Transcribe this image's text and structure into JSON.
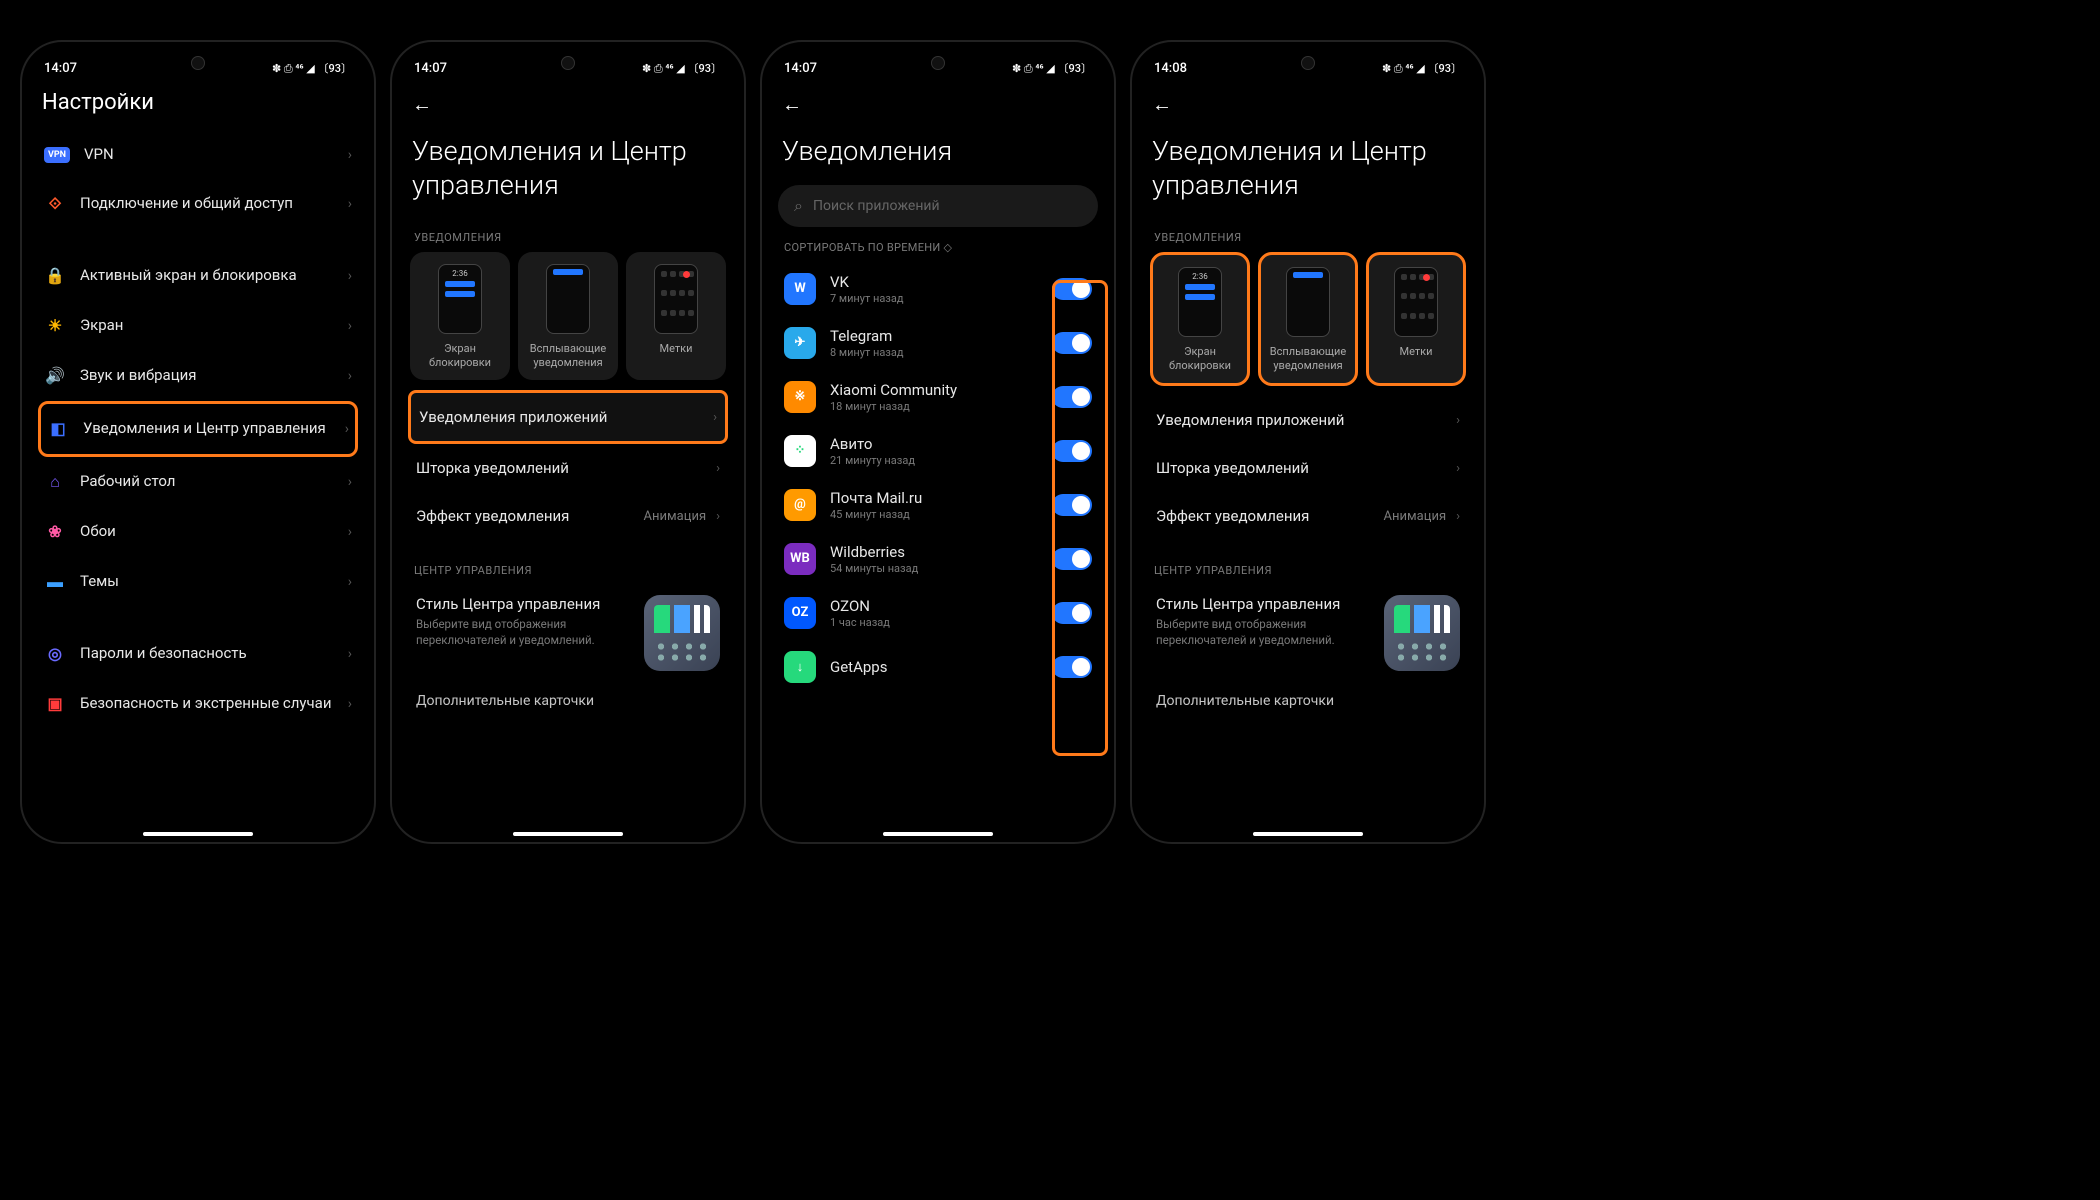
{
  "status": {
    "time1": "14:07",
    "time4": "14:08",
    "icons": "✽ ⎙ ⁴⁶ ◢ 〔93〕"
  },
  "s1": {
    "title": "Настройки",
    "items": [
      {
        "icon": "vpn",
        "label": "VPN"
      },
      {
        "icon": "share",
        "label": "Подключение и общий доступ"
      },
      {
        "icon": "lock",
        "label": "Активный экран и блокировка"
      },
      {
        "icon": "sun",
        "label": "Экран"
      },
      {
        "icon": "sound",
        "label": "Звук и вибрация"
      },
      {
        "icon": "notif",
        "label": "Уведомления и Центр управления",
        "hi": true
      },
      {
        "icon": "home",
        "label": "Рабочий стол"
      },
      {
        "icon": "wall",
        "label": "Обои"
      },
      {
        "icon": "theme",
        "label": "Темы"
      },
      {
        "icon": "pwd",
        "label": "Пароли и безопасность"
      },
      {
        "icon": "sos",
        "label": "Безопасность и экстренные случаи"
      }
    ]
  },
  "s2": {
    "title": "Уведомления и Центр управления",
    "sect1": "УВЕДОМЛЕНИЯ",
    "cards": [
      {
        "cap": "Экран блокировки",
        "time": "2:36"
      },
      {
        "cap": "Всплывающие уведомления"
      },
      {
        "cap": "Метки"
      }
    ],
    "rows": [
      {
        "lab": "Уведомления приложений",
        "hi": true
      },
      {
        "lab": "Шторка уведомлений"
      },
      {
        "lab": "Эффект уведомления",
        "val": "Анимация"
      }
    ],
    "sect2": "ЦЕНТР УПРАВЛЕНИЯ",
    "cc": {
      "h": "Стиль Центра управления",
      "d": "Выберите вид отображения переключателей и уведомлений."
    },
    "cut": "Дополнительные карточки"
  },
  "s3": {
    "title": "Уведомления",
    "search": "Поиск приложений",
    "sort": "СОРТИРОВАТЬ ПО ВРЕМЕНИ ◇",
    "apps": [
      {
        "nm": "VK",
        "tm": "7 минут назад",
        "bg": "#2176ff",
        "tx": "W"
      },
      {
        "nm": "Telegram",
        "tm": "8 минут назад",
        "bg": "#29a9eb",
        "tx": "✈"
      },
      {
        "nm": "Xiaomi Community",
        "tm": "18 минут назад",
        "bg": "#ff8a00",
        "tx": "※"
      },
      {
        "nm": "Авито",
        "tm": "21 минуту назад",
        "bg": "#fff",
        "tx": "⁘"
      },
      {
        "nm": "Почта Mail.ru",
        "tm": "45 минут назад",
        "bg": "#ff9a00",
        "tx": "@"
      },
      {
        "nm": "Wildberries",
        "tm": "54 минуты назад",
        "bg": "#7b2cbf",
        "tx": "WB"
      },
      {
        "nm": "OZON",
        "tm": "1 час назад",
        "bg": "#0058ff",
        "tx": "OZ"
      },
      {
        "nm": "GetApps",
        "tm": "",
        "bg": "#26d97c",
        "tx": "↓"
      }
    ]
  }
}
